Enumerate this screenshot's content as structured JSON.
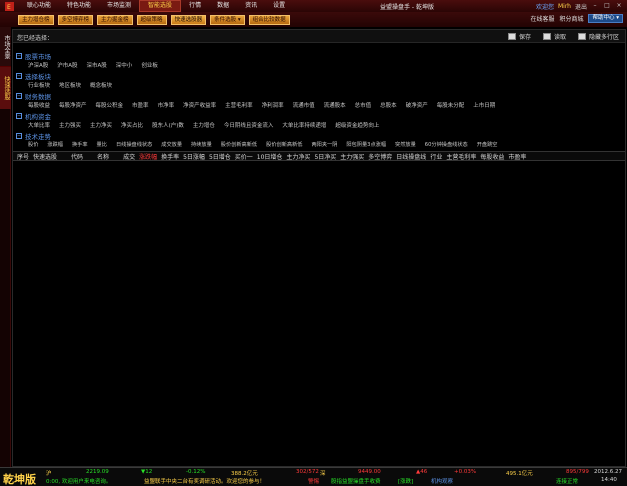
{
  "app": {
    "window_title": "益盟操盘手 - 乾坤版"
  },
  "menu": {
    "items": [
      "联心功能",
      "特色功能",
      "市场监测",
      "智能选股",
      "行情",
      "数据",
      "资讯",
      "设置"
    ]
  },
  "topright": {
    "welcome": "欢迎您",
    "user": "Mirh",
    "logout": "退出"
  },
  "toolbar": {
    "buttons": [
      "主力增仓榜",
      "多空博弈榜",
      "主力掘金榜",
      "超级策略",
      "快速选股器",
      "条件选股 ▾",
      "组合比较数据"
    ],
    "right_links": [
      "在线客服",
      "积分商城"
    ],
    "help_label": "帮助中心 ▾"
  },
  "leftstrip": {
    "tab_a": "市场全景",
    "tab_b": "快速选股"
  },
  "panel": {
    "header_label": "您已经选择：",
    "actions": {
      "save": "保存",
      "read": "读取",
      "hide": "隐藏多行区"
    },
    "sections": {
      "market": {
        "title": "股票市场",
        "items": [
          "沪深A股",
          "沪市A股",
          "深市A股",
          "深中小",
          "创业板"
        ]
      },
      "sector": {
        "title": "选择板块",
        "items": [
          "行业板块",
          "地区板块",
          "概念板块"
        ]
      },
      "finance": {
        "title": "财务数据",
        "items": [
          "每股收益",
          "每股净资产",
          "每股公积金",
          "市盈率",
          "市净率",
          "净资产收益率",
          "主营毛利率",
          "净利润率",
          "流通市值",
          "流通股本",
          "总市值",
          "总股本",
          "破净资产",
          "每股未分配",
          "上市日期"
        ]
      },
      "fund": {
        "title": "机构资金",
        "items": [
          "大单比率",
          "主力强买",
          "主力净买",
          "净买占比",
          "股东人(户)数",
          "主力增仓",
          "今日阴线且资金流入",
          "大单比率持续递增",
          "超级资金趋势向上"
        ]
      },
      "tech": {
        "title": "技术走势",
        "items": [
          "股价",
          "涨跌幅",
          "换手率",
          "量比",
          "日线操盘线状态",
          "成交放量",
          "持续放量",
          "股价创新高新低",
          "股价创新高新低",
          "两阳夹一阴",
          "阳包阴量3点涨幅",
          "突然放量",
          "60分钟操盘线状态",
          "开盘跳空"
        ]
      }
    },
    "columns": [
      "序号",
      "快速选股",
      "代码",
      "名称",
      "成交",
      "涨跌幅",
      "换手率",
      "5日涨幅",
      "5日增仓",
      "买价一",
      "10日增仓",
      "主力净买",
      "5日净买",
      "主力强买",
      "多空博弈",
      "日线操盘线",
      "行业",
      "主营毛利率",
      "每股收益",
      "市盈率"
    ]
  },
  "status": {
    "brand": "乾坤版",
    "sh": {
      "label": "沪",
      "index": "2219.09",
      "change_arrow": "▼12",
      "change_pct": "-0.12%",
      "amount": "388.2亿元",
      "updown": "302/572"
    },
    "sz": {
      "label": "深",
      "index": "9449.00",
      "change_arrow": "▲46",
      "change_pct": "+0.03%",
      "amount": "495.1亿元",
      "updown": "895/799"
    },
    "date": "2012.6.27",
    "time": "14:40",
    "news": "0:00, 欢迎用户来电咨询。",
    "news2": "益盟联手中央二台有奖调研活动。欢迎您的参与！",
    "alert_label": "警惕",
    "alert_text": "股指益盟操盘手收费",
    "market_state": "[涨跌]",
    "market_state2": "机构观察",
    "conn": "连接正常"
  },
  "colors": {
    "accent_red": "#ff3a3a",
    "accent_yellow": "#ffd24a",
    "accent_blue": "#5a8fe0",
    "down_green": "#28e028"
  }
}
